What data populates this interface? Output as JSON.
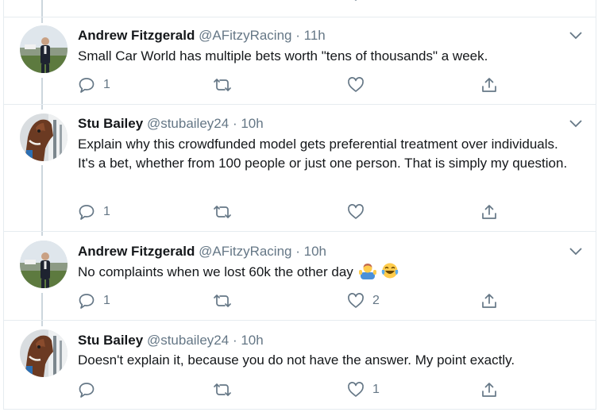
{
  "tweets": [
    {
      "name": "Andrew Fitzgerald",
      "handle": "@AFitzyRacing",
      "dot": "·",
      "time": "11h",
      "text": "Small Car World has multiple bets worth \"tens of thousands\" a week.",
      "reply_count": "1",
      "retweet_count": "",
      "like_count": "",
      "avatar": "andrew-fitzgerald-avatar"
    },
    {
      "name": "Stu Bailey",
      "handle": "@stubailey24",
      "dot": "·",
      "time": "10h",
      "text": "Explain why this crowdfunded model gets preferential treatment over individuals. It's a bet, whether from 100 people or just one person.  That is simply my question.",
      "reply_count": "1",
      "retweet_count": "",
      "like_count": "",
      "avatar": "stu-bailey-avatar"
    },
    {
      "name": "Andrew Fitzgerald",
      "handle": "@AFitzyRacing",
      "dot": "·",
      "time": "10h",
      "text": "No complaints when we lost 60k the other day",
      "emojis": [
        "man-shrugging-emoji",
        "face-with-tears-of-joy-emoji"
      ],
      "reply_count": "1",
      "retweet_count": "",
      "like_count": "2",
      "avatar": "andrew-fitzgerald-avatar"
    },
    {
      "name": "Stu Bailey",
      "handle": "@stubailey24",
      "dot": "·",
      "time": "10h",
      "text": "Doesn't explain it, because you do not have the answer. My point exactly.",
      "reply_count": "",
      "retweet_count": "",
      "like_count": "1",
      "avatar": "stu-bailey-avatar"
    }
  ],
  "colors": {
    "text": "#14171a",
    "secondary": "#657786",
    "divider": "#e6ecf0",
    "thread_line": "#ccd6dd"
  },
  "icons": [
    "reply-icon",
    "retweet-icon",
    "like-icon",
    "share-icon",
    "chevron-down-icon"
  ]
}
